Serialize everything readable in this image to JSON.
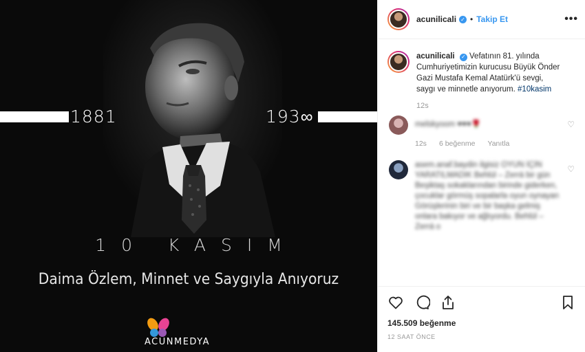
{
  "image": {
    "year_birth": "1881",
    "year_death": "193∞",
    "title": "10 KASIM",
    "tribute": "Daima Özlem, Minnet ve Saygıyla Anıyoruz",
    "brand": "ACUNMEDYA"
  },
  "header": {
    "username": "acunilicali",
    "follow_label": "Takip Et",
    "more_icon": "•••"
  },
  "caption": {
    "username": "acunilicali",
    "text": "Vefatının 81. yılında Cumhuriyetimizin kurucusu Büyük Önder Gazi Mustafa Kemal Atatürk'ü sevgi, saygı ve minnetle anıyorum.",
    "hashtag": "#10kasim",
    "time": "12s"
  },
  "comments": [
    {
      "text": "melskyoom ♥♥♥🌹",
      "time": "12s",
      "likes": "6 beğenme",
      "reply": "Yanıtla"
    },
    {
      "text": "asem.anaf.baydin ilgisiz OYUN İÇİN YARATILMADIK Behlül – Zerrá bir gün Beşiktaş sokaklarından birinde giderken, çocuklar görmüş sopalarla oyun oynayan Görüşlerinin biri ve bir başka gelmiş onlara bakıyor ve ağlıyordu. Behlül – Zerrá o"
    }
  ],
  "actions": {
    "likes": "145.509 beğenme",
    "timestamp": "12 SAAT ÖNCE"
  },
  "colors": {
    "accent": "#3897f0",
    "image_background": "#0a0a0a"
  }
}
